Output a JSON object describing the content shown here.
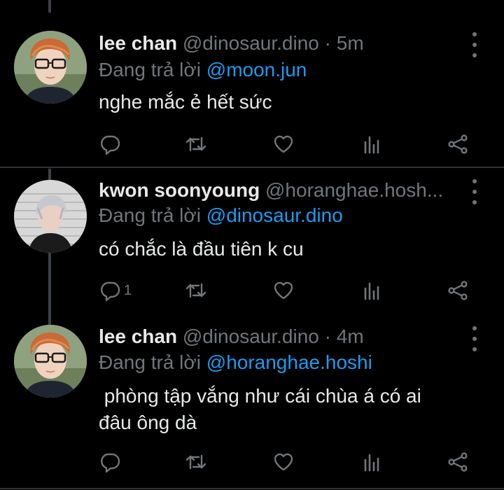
{
  "colors": {
    "background": "#000000",
    "text_primary": "#e7e9ea",
    "text_secondary": "#71767b",
    "mention": "#1d9bf0",
    "divider": "#2f3336"
  },
  "tweets": [
    {
      "name": "lee chan",
      "handle": "@dinosaur.dino",
      "separator": "·",
      "time": "5m",
      "reply_prefix": "Đang trả lời",
      "reply_to": "@moon.jun",
      "text": "nghe mắc ẻ hết sức",
      "avatar_icon": "user-avatar-glasses",
      "actions": {
        "reply": {
          "icon": "reply-icon",
          "count": ""
        },
        "retweet": {
          "icon": "retweet-icon"
        },
        "like": {
          "icon": "heart-icon"
        },
        "views": {
          "icon": "analytics-icon"
        },
        "share": {
          "icon": "share-icon"
        }
      }
    },
    {
      "name": "kwon soonyoung",
      "handle": "@horanghae.hosh...",
      "separator": "",
      "time": "",
      "reply_prefix": "Đang trả lời",
      "reply_to": "@dinosaur.dino",
      "text": "có chắc là đầu tiên k cu",
      "avatar_icon": "user-avatar-light-hair",
      "actions": {
        "reply": {
          "icon": "reply-icon",
          "count": "1"
        },
        "retweet": {
          "icon": "retweet-icon"
        },
        "like": {
          "icon": "heart-icon"
        },
        "views": {
          "icon": "analytics-icon"
        },
        "share": {
          "icon": "share-icon"
        }
      }
    },
    {
      "name": "lee chan",
      "handle": "@dinosaur.dino",
      "separator": "·",
      "time": "4m",
      "reply_prefix": "Đang trả lời",
      "reply_to": "@horanghae.hoshi",
      "text": " phòng tập vắng như cái chùa á có ai đâu ông dà",
      "avatar_icon": "user-avatar-glasses",
      "actions": {
        "reply": {
          "icon": "reply-icon",
          "count": ""
        },
        "retweet": {
          "icon": "retweet-icon"
        },
        "like": {
          "icon": "heart-icon"
        },
        "views": {
          "icon": "analytics-icon"
        },
        "share": {
          "icon": "share-icon"
        }
      }
    }
  ]
}
